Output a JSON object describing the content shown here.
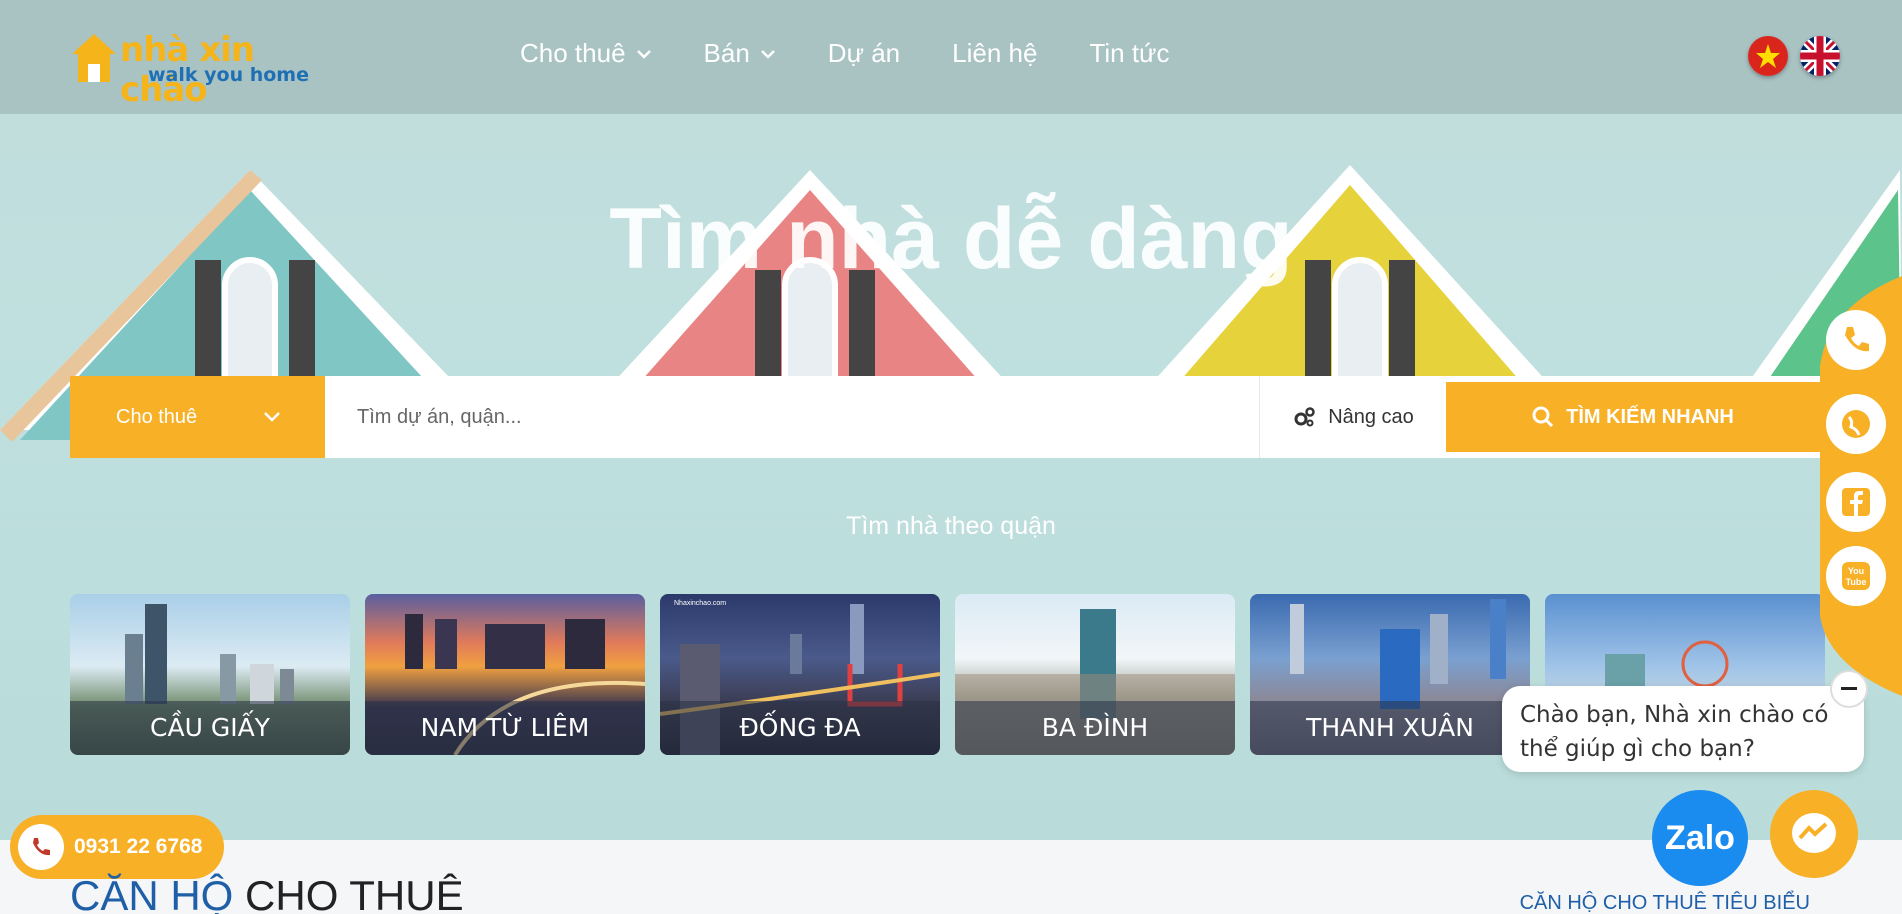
{
  "header": {
    "logo_main": "nhà xin chào",
    "logo_sub": "walk you home",
    "nav": [
      {
        "label": "Cho thuê",
        "has_dropdown": true
      },
      {
        "label": "Bán",
        "has_dropdown": true
      },
      {
        "label": "Dự án",
        "has_dropdown": false
      },
      {
        "label": "Liên hệ",
        "has_dropdown": false
      },
      {
        "label": "Tin tức",
        "has_dropdown": false
      }
    ],
    "flags": [
      "vietnam-flag-icon",
      "uk-flag-icon"
    ]
  },
  "hero": {
    "title": "Tìm nhà dễ dàng"
  },
  "search": {
    "type_label": "Cho thuê",
    "placeholder": "Tìm dự án, quận...",
    "advanced_label": "Nâng cao",
    "button_label": "TÌM KIẾM NHANH"
  },
  "districts": {
    "heading": "Tìm nhà theo quận",
    "items": [
      {
        "label": "CẦU GIẤY"
      },
      {
        "label": "NAM TỪ LIÊM"
      },
      {
        "label": "ĐỐNG ĐA",
        "watermark": "Nhaxinchao.com"
      },
      {
        "label": "BA ĐÌNH"
      },
      {
        "label": "THANH XUÂN"
      },
      {
        "label": ""
      }
    ]
  },
  "social": [
    "phone-icon",
    "globe-icon",
    "facebook-icon",
    "youtube-icon"
  ],
  "chat": {
    "message": "Chào bạn, Nhà xin chào có thể giúp gì cho bạn?",
    "zalo_label": "Zalo"
  },
  "phone": {
    "number": "0931 22 6768"
  },
  "section": {
    "title_part1": "CĂN HỘ",
    "title_part2": "CHO THUÊ",
    "link": "CĂN HỘ CHO THUÊ TIÊU BIỂU"
  },
  "colors": {
    "accent": "#f8b026",
    "brand_blue": "#1f5fa8"
  }
}
